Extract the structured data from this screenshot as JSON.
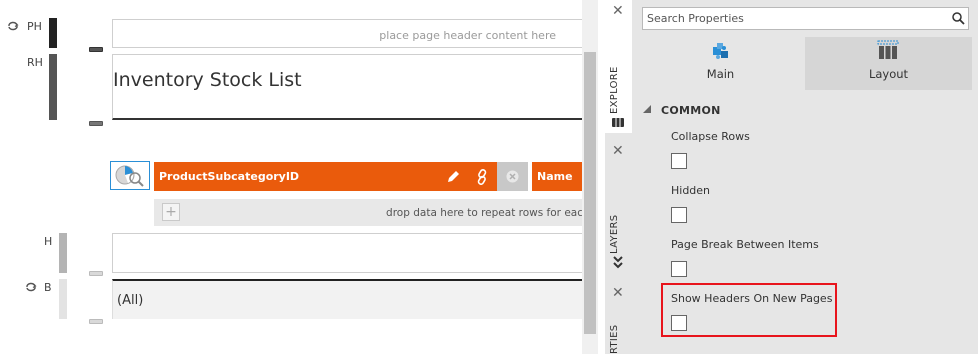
{
  "canvas": {
    "bands": {
      "ph_label": "PH",
      "rh_label": "RH",
      "h_label": "H",
      "b_label": "B"
    },
    "page_header_placeholder": "place page header content here",
    "report_title": "Inventory Stock List",
    "fields": {
      "field1_label": "ProductSubcategoryID",
      "field2_label": "Name"
    },
    "drop_zone_text": "drop data here to repeat rows for eac",
    "group_value": "(All)"
  },
  "side_tabs": {
    "explore": "EXPLORE",
    "layers": "LAYERS",
    "properties": "RTIES"
  },
  "properties": {
    "search_placeholder": "Search Properties",
    "tabs": [
      {
        "label": "Main",
        "icon": "main-puzzle-icon"
      },
      {
        "label": "Layout",
        "icon": "layout-columns-icon"
      }
    ],
    "section_title": "COMMON",
    "items": [
      {
        "label": "Collapse Rows",
        "checked": false
      },
      {
        "label": "Hidden",
        "checked": false
      },
      {
        "label": "Page Break Between Items",
        "checked": false
      },
      {
        "label": "Show Headers On New Pages",
        "checked": false
      }
    ]
  },
  "colors": {
    "field_orange": "#ea5b0c",
    "highlight_red": "#e8141c",
    "icon_blue": "#2a8fd6"
  }
}
